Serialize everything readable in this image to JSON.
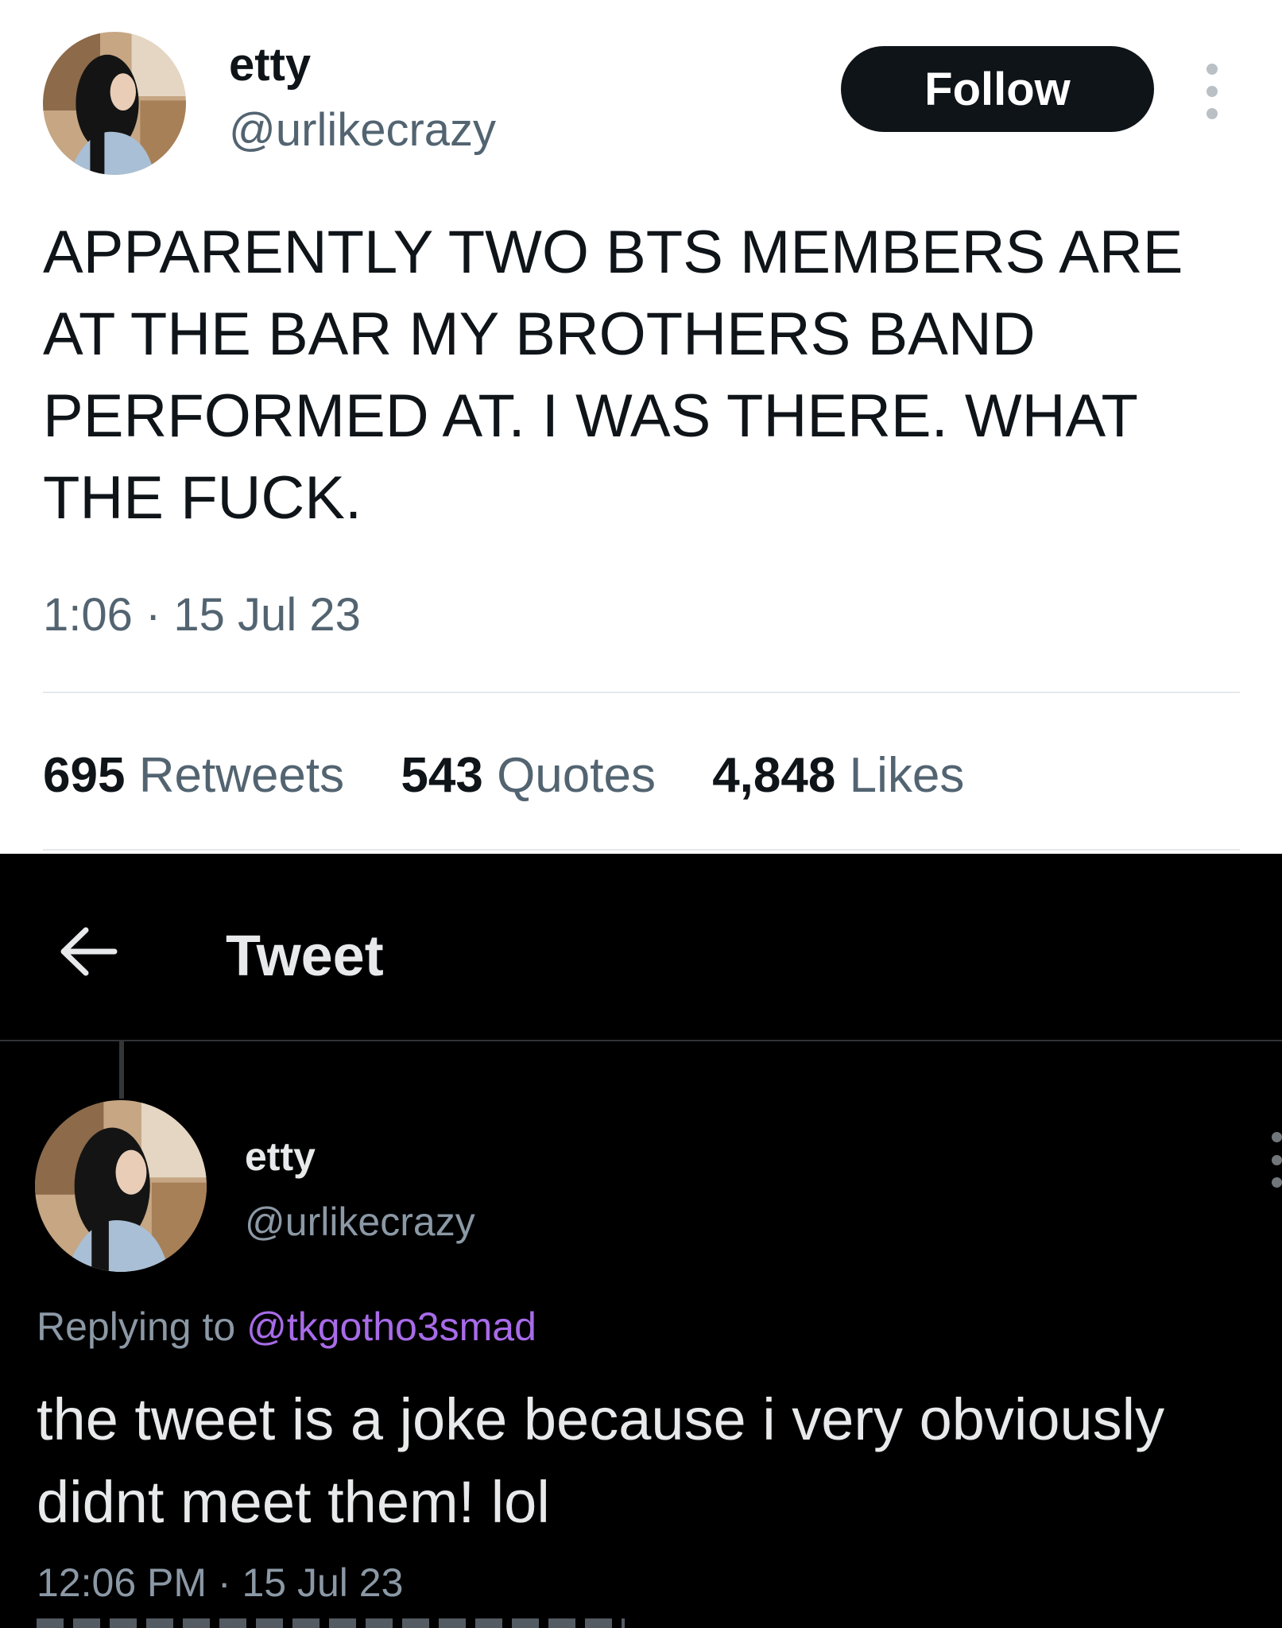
{
  "top_tweet": {
    "author": {
      "name": "etty",
      "handle": "@urlikecrazy"
    },
    "follow_label": "Follow",
    "text": "APPARENTLY TWO BTS MEMBERS ARE AT THE BAR MY BROTHERS BAND PERFORMED AT. I WAS THERE. WHAT THE FUCK.",
    "timestamp": "1:06 · 15 Jul 23",
    "stats": [
      {
        "count": "695",
        "label": "Retweets"
      },
      {
        "count": "543",
        "label": "Quotes"
      },
      {
        "count": "4,848",
        "label": "Likes"
      }
    ]
  },
  "reply_tweet": {
    "header_title": "Tweet",
    "author": {
      "name": "etty",
      "handle": "@urlikecrazy"
    },
    "replying_prefix": "Replying to",
    "replying_to": "@tkgotho3smad",
    "text_lines": [
      "the tweet is a joke because i very obviously",
      "didnt meet them! lol"
    ],
    "timestamp": "12:06 PM · 15 Jul 23"
  },
  "colors": {
    "light_bg": "#ffffff",
    "dark_bg": "#000000",
    "mention": "#a86be8",
    "follow_button": "#0f1419"
  },
  "icons": [
    "back-arrow-icon",
    "more-options-icon"
  ]
}
